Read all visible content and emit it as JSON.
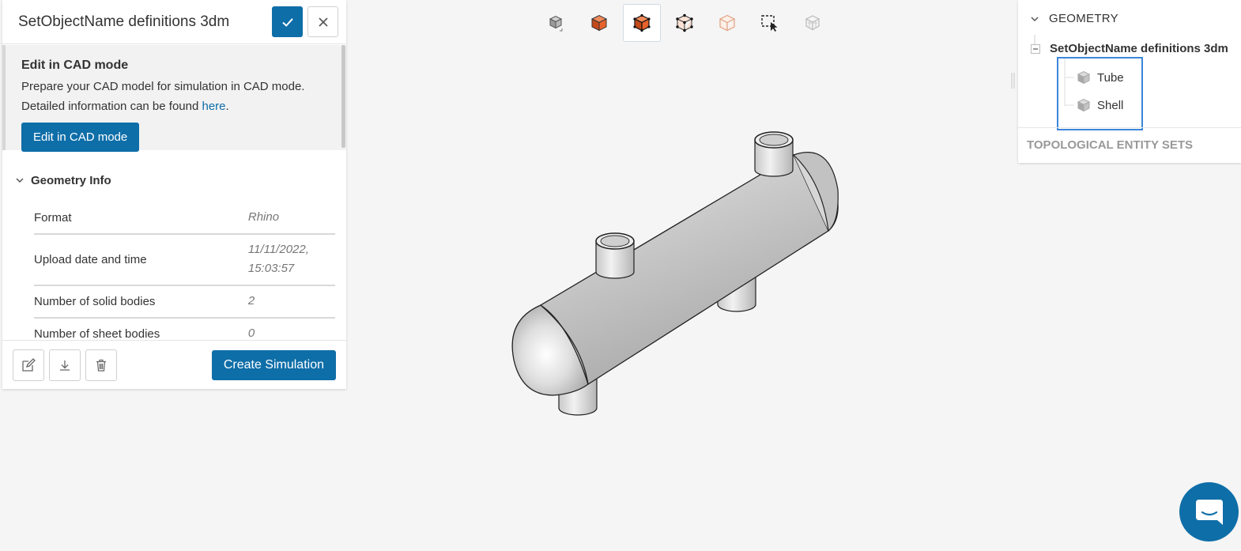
{
  "panel": {
    "title": "SetObjectName definitions 3dm",
    "cad": {
      "title": "Edit in CAD mode",
      "text1": "Prepare your CAD model for simulation in CAD mode. Detailed information can be found ",
      "link": "here",
      "text2": ".",
      "button": "Edit in CAD mode"
    },
    "info": {
      "title": "Geometry Info",
      "rows": [
        {
          "label": "Format",
          "value": "Rhino"
        },
        {
          "label": "Upload date and time",
          "value": "11/11/2022, 15:03:57"
        },
        {
          "label": "Number of solid bodies",
          "value": "2"
        },
        {
          "label": "Number of sheet bodies",
          "value": "0"
        }
      ]
    },
    "footer": {
      "create_label": "Create Simulation"
    }
  },
  "toolbar": {
    "icons": [
      "cube-view-icon",
      "solid-view-icon",
      "solid-edges-view-icon",
      "wireframe-points-view-icon",
      "transparent-view-icon",
      "box-select-icon",
      "hidden-wireframe-icon"
    ],
    "active_index": 2,
    "accent": "#e8632b"
  },
  "tree": {
    "header": "GEOMETRY",
    "root": "SetObjectName definitions 3dm",
    "children": [
      "Tube",
      "Shell"
    ],
    "topo": "TOPOLOGICAL ENTITY SETS"
  },
  "colors": {
    "primary": "#0e6ea8",
    "highlight": "#3b86da"
  }
}
